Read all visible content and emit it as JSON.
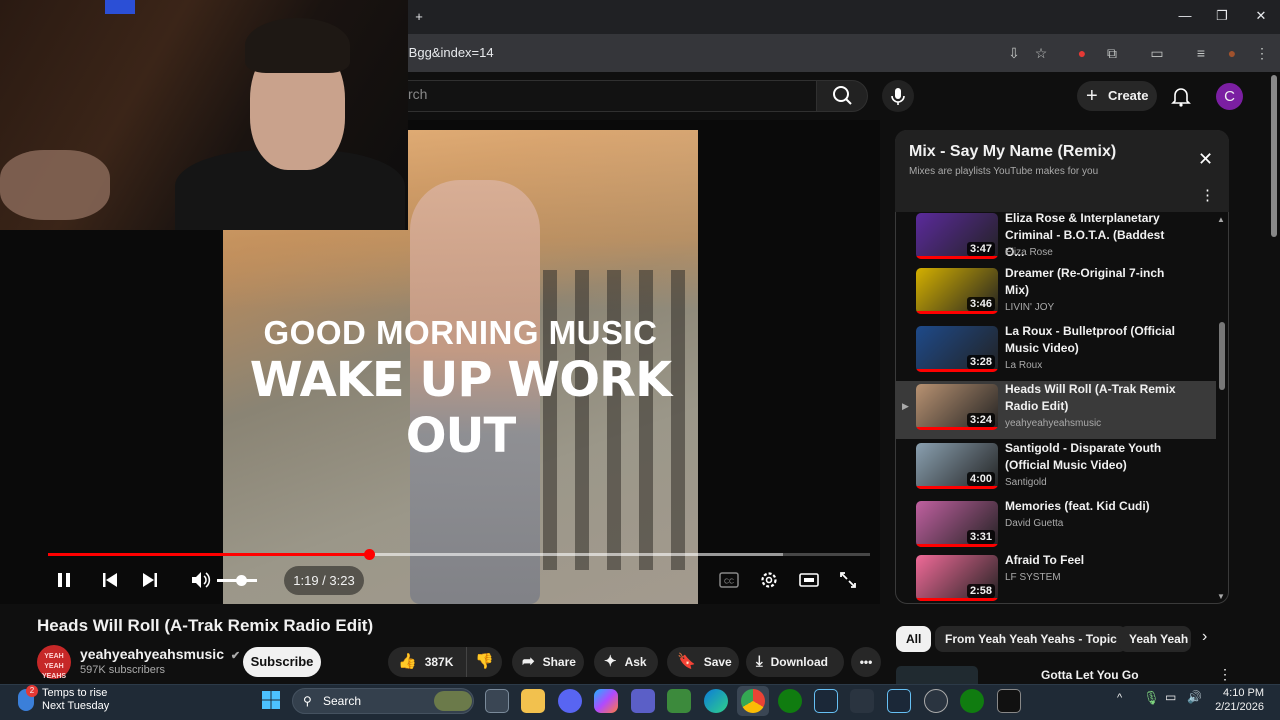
{
  "browser": {
    "url_fragment": "BBgg&index=14",
    "new_tab": "+",
    "window_controls": [
      "—",
      "❐",
      "✕"
    ]
  },
  "header": {
    "search_placeholder": "rch",
    "create_label": "Create",
    "avatar_letter": "C"
  },
  "player": {
    "overlay_line1": "GOOD MORNING MUSIC",
    "overlay_line2": "WAKE UP WORK OUT",
    "time_display": "1:19 / 3:23",
    "progress_fraction": 0.39,
    "volume_fraction": 0.5
  },
  "video": {
    "title": "Heads Will Roll (A-Trak Remix Radio Edit)",
    "channel_name": "yeahyeahyeahsmusic",
    "channel_logo_text": "YEAH YEAH YEAHS",
    "subscribers": "597K subscribers",
    "subscribe_label": "Subscribe",
    "likes": "387K",
    "share_label": "Share",
    "ask_label": "Ask",
    "save_label": "Save",
    "download_label": "Download"
  },
  "mix": {
    "title": "Mix - Say My Name (Remix)",
    "subtitle": "Mixes are playlists YouTube makes for you",
    "items": [
      {
        "title": "Eliza Rose & Interplanetary Criminal - B.O.T.A. (Baddest O...",
        "channel": "Eliza Rose",
        "duration": "3:47",
        "color": "#5b2a9c",
        "active": false
      },
      {
        "title": "Dreamer (Re-Original 7-inch Mix)",
        "channel": "LIVIN' JOY",
        "duration": "3:46",
        "color": "#d4b000",
        "active": false
      },
      {
        "title": "La Roux - Bulletproof (Official Music Video)",
        "channel": "La Roux",
        "duration": "3:28",
        "color": "#1e4a8a",
        "active": false
      },
      {
        "title": "Heads Will Roll (A-Trak Remix Radio Edit)",
        "channel": "yeahyeahyeahsmusic",
        "duration": "3:24",
        "color": "#b89272",
        "active": true
      },
      {
        "title": "Santigold - Disparate Youth (Official Music Video)",
        "channel": "Santigold",
        "duration": "4:00",
        "color": "#8aa0b0",
        "active": false
      },
      {
        "title": "Memories (feat. Kid Cudi)",
        "channel": "David Guetta",
        "duration": "3:31",
        "color": "#c060a0",
        "active": false
      },
      {
        "title": "Afraid To Feel",
        "channel": "LF SYSTEM",
        "duration": "2:58",
        "color": "#f06a98",
        "active": false
      }
    ]
  },
  "chips": [
    "All",
    "From Yeah Yeah Yeahs - Topic",
    "Yeah Yeah"
  ],
  "up_next_title": "Gotta Let You Go",
  "taskbar": {
    "weather_title": "Temps to rise",
    "weather_sub": "Next Tuesday",
    "weather_badge": "2",
    "search_label": "Search",
    "time": "4:10 PM",
    "date": "2/21/2026"
  }
}
